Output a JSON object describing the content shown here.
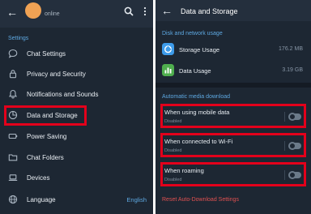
{
  "left": {
    "status": "online",
    "section_title": "Settings",
    "items": [
      {
        "label": "Chat Settings",
        "icon": "chat-bubble-icon"
      },
      {
        "label": "Privacy and Security",
        "icon": "lock-icon"
      },
      {
        "label": "Notifications and Sounds",
        "icon": "bell-icon"
      },
      {
        "label": "Data and Storage",
        "icon": "pie-chart-icon"
      },
      {
        "label": "Power Saving",
        "icon": "battery-icon"
      },
      {
        "label": "Chat Folders",
        "icon": "folder-icon"
      },
      {
        "label": "Devices",
        "icon": "laptop-icon"
      },
      {
        "label": "Language",
        "icon": "globe-icon",
        "value": "English"
      }
    ]
  },
  "right": {
    "title": "Data and Storage",
    "usage_section_title": "Disk and network usage",
    "storage_usage": {
      "label": "Storage Usage",
      "value": "176.2 MB"
    },
    "data_usage": {
      "label": "Data Usage",
      "value": "3.19 GB"
    },
    "auto_section_title": "Automatic media download",
    "options": [
      {
        "title": "When using mobile data",
        "status": "Disabled"
      },
      {
        "title": "When connected to Wi-Fi",
        "status": "Disabled"
      },
      {
        "title": "When roaming",
        "status": "Disabled"
      }
    ],
    "reset_label": "Reset Auto-Download Settings"
  },
  "colors": {
    "background": "#1d2733",
    "accent": "#5ea9e2",
    "highlight": "#e3001b",
    "storage_icon": "#3d9be9",
    "data_icon": "#4fae4e",
    "reset": "#e05151"
  }
}
